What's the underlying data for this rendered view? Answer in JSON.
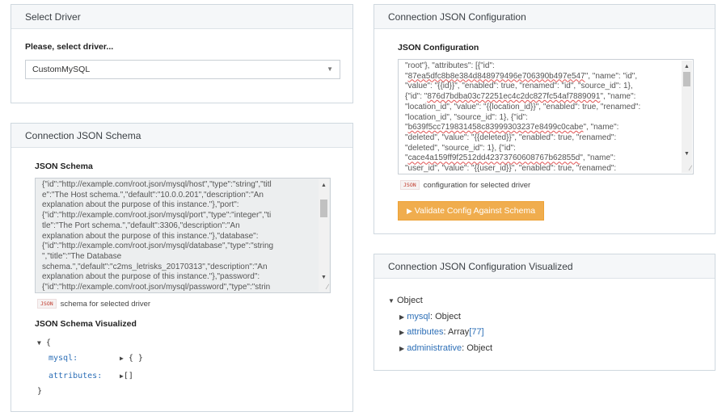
{
  "select_driver": {
    "title": "Select Driver",
    "prompt_label": "Please, select driver...",
    "selected": "CustomMySQL"
  },
  "schema_panel": {
    "title": "Connection JSON Schema",
    "label": "JSON Schema",
    "textarea_lines": [
      "{\"id\":\"http://example.com/root.json/mysql/host\",\"type\":\"string\",\"titl",
      "e\":\"The Host schema.\",\"default\":\"10.0.0.201\",\"description\":\"An",
      "explanation about the purpose of this instance.\"},\"port\":",
      "{\"id\":\"http://example.com/root.json/mysql/port\",\"type\":\"integer\",\"ti",
      "tle\":\"The Port schema.\",\"default\":3306,\"description\":\"An",
      "explanation about the purpose of this instance.\"},\"database\":",
      "{\"id\":\"http://example.com/root.json/mysql/database\",\"type\":\"string",
      "\",\"title\":\"The Database",
      "schema.\",\"default\":\"c2ms_letrisks_20170313\",\"description\":\"An",
      "explanation about the purpose of this instance.\"},\"password\":",
      "{\"id\":\"http://example.com/root.json/mysql/password\",\"type\":\"strin"
    ],
    "badge": "JSON",
    "helper": "schema for selected driver",
    "visualized_label": "JSON Schema Visualized",
    "tree": {
      "open_brace": "{",
      "close_brace": "}",
      "items": [
        {
          "key": "mysql:",
          "value": "{ }"
        },
        {
          "key": "attributes:",
          "value": "[]"
        }
      ]
    }
  },
  "config_panel": {
    "title": "Connection JSON Configuration",
    "label": "JSON Configuration",
    "textarea_lines": [
      "\"root\"}, \"attributes\": [{\"id\":",
      "\"87ea5dfc8b8e384d848979496e706390b497e547\", \"name\": \"id\",",
      "\"value\": \"{{id}}\", \"enabled\": true, \"renamed\": \"id\", \"source_id\": 1},",
      "{\"id\": \"876d7bdba03c72251ec4c2dc827fc54af7889091\", \"name\":",
      "\"location_id\", \"value\": \"{{location_id}}\", \"enabled\": true, \"renamed\":",
      "\"location_id\", \"source_id\": 1}, {\"id\":",
      "\"b639f5cc719831458c83999303237e8499c0cabe\", \"name\":",
      "\"deleted\", \"value\": \"{{deleted}}\", \"enabled\": true, \"renamed\":",
      "\"deleted\", \"source_id\": 1}, {\"id\":",
      "\"cace4a159ff9f2512dd42373760608767b62855d\", \"name\":",
      "\"user_id\", \"value\": \"{{user_id}}\", \"enabled\": true, \"renamed\":"
    ],
    "badge": "JSON",
    "helper": "configuration for selected driver",
    "validate_button": "Validate Config Against Schema"
  },
  "visualized_panel": {
    "title": "Connection JSON Configuration Visualized",
    "root_label": "Object",
    "items": [
      {
        "key": "mysql",
        "sep": ": ",
        "type": "Object",
        "count": ""
      },
      {
        "key": "attributes",
        "sep": ": ",
        "type": "Array",
        "count": "[77]"
      },
      {
        "key": "administrative",
        "sep": ": ",
        "type": "Object",
        "count": ""
      }
    ]
  },
  "icons": {
    "dropdown": "chevron-down-icon",
    "caret_down": "caret-down-icon",
    "caret_right": "caret-right-icon",
    "play": "play-icon"
  },
  "colors": {
    "accent_button": "#f0ad4e",
    "key_blue": "#2d6fb7",
    "panel_header": "#f5f7f9"
  }
}
